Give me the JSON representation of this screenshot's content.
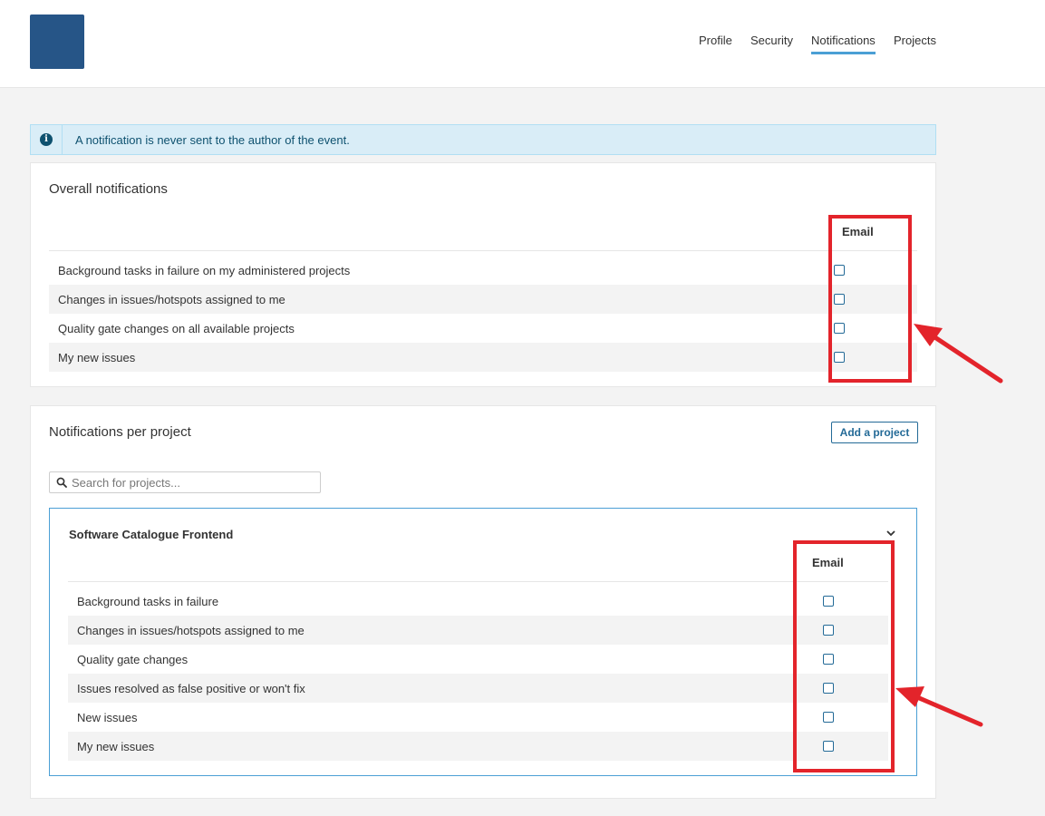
{
  "nav": {
    "items": [
      {
        "label": "Profile",
        "active": false
      },
      {
        "label": "Security",
        "active": false
      },
      {
        "label": "Notifications",
        "active": true
      },
      {
        "label": "Projects",
        "active": false
      }
    ]
  },
  "info": {
    "icon": "info-circle-icon",
    "text": "A notification is never sent to the author of the event."
  },
  "overall": {
    "title": "Overall notifications",
    "column_header": "Email",
    "rows": [
      {
        "label": "Background tasks in failure on my administered projects",
        "email_checked": false
      },
      {
        "label": "Changes in issues/hotspots assigned to me",
        "email_checked": false
      },
      {
        "label": "Quality gate changes on all available projects",
        "email_checked": false
      },
      {
        "label": "My new issues",
        "email_checked": false
      }
    ]
  },
  "per_project": {
    "title": "Notifications per project",
    "add_button_label": "Add a project",
    "search_placeholder": "Search for projects...",
    "project": {
      "name": "Software Catalogue Frontend",
      "column_header": "Email",
      "rows": [
        {
          "label": "Background tasks in failure",
          "email_checked": false
        },
        {
          "label": "Changes in issues/hotspots assigned to me",
          "email_checked": false
        },
        {
          "label": "Quality gate changes",
          "email_checked": false
        },
        {
          "label": "Issues resolved as false positive or won't fix",
          "email_checked": false
        },
        {
          "label": "New issues",
          "email_checked": false
        },
        {
          "label": "My new issues",
          "email_checked": false
        }
      ]
    }
  },
  "colors": {
    "accent": "#4b9fd5",
    "primary": "#236a97",
    "info_bg": "#d9edf7",
    "annotation": "#e3242b"
  }
}
